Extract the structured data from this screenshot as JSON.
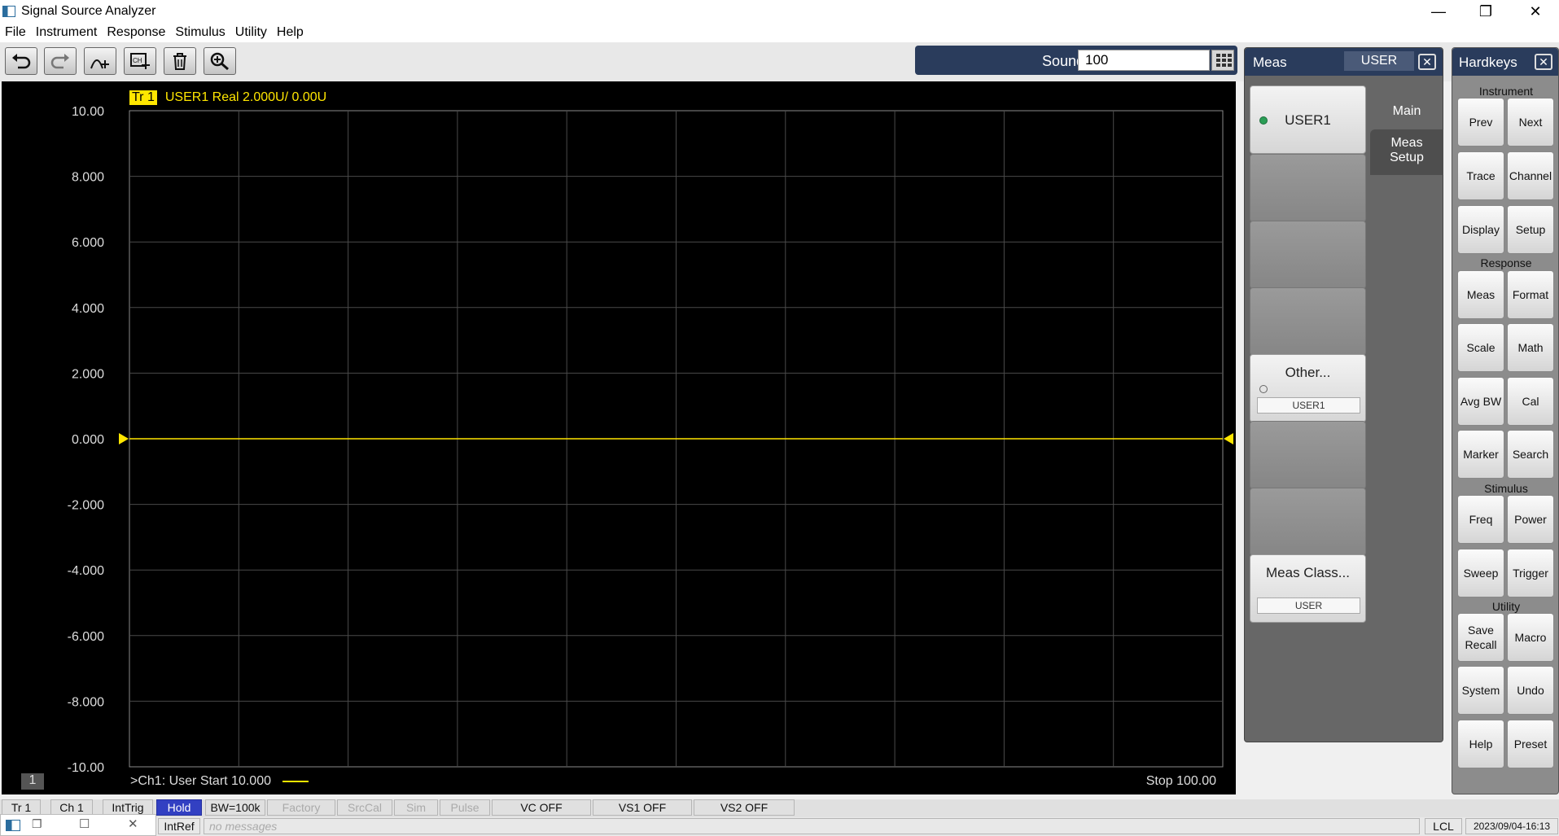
{
  "window": {
    "title": "Signal Source Analyzer"
  },
  "menu": [
    "File",
    "Instrument",
    "Response",
    "Stimulus",
    "Utility",
    "Help"
  ],
  "entry": {
    "label": "Sound",
    "value": "100"
  },
  "plot": {
    "trace_badge": "Tr 1",
    "trace_info": "USER1 Real 2.000U/  0.00U",
    "y_ticks": [
      "10.00",
      "8.000",
      "6.000",
      "4.000",
      "2.000",
      "0.000",
      "-2.000",
      "-4.000",
      "-6.000",
      "-8.000",
      "-10.00"
    ],
    "channel_number": "1",
    "footer_left": ">Ch1: User  Start  10.000",
    "footer_right": "Stop  100.00",
    "trace_color": "#ffe600"
  },
  "chart_data": {
    "type": "line",
    "x": [
      10.0,
      100.0
    ],
    "xlim": [
      10.0,
      100.0
    ],
    "ylim": [
      -10.0,
      10.0
    ],
    "series": [
      {
        "name": "USER1",
        "values": [
          0.0,
          0.0
        ]
      }
    ],
    "grid": true
  },
  "meas_panel": {
    "title": "Meas",
    "mode": "USER",
    "softkeys": [
      {
        "label": "USER1",
        "radio": "on",
        "sub": ""
      },
      {
        "label": "",
        "radio": "",
        "sub": ""
      },
      {
        "label": "",
        "radio": "",
        "sub": ""
      },
      {
        "label": "",
        "radio": "",
        "sub": ""
      },
      {
        "label": "Other...",
        "radio": "off",
        "sub": "USER1"
      },
      {
        "label": "",
        "radio": "",
        "sub": ""
      },
      {
        "label": "",
        "radio": "",
        "sub": ""
      },
      {
        "label": "Meas Class...",
        "radio": "",
        "sub": "USER"
      }
    ],
    "tabs": {
      "main": "Main",
      "meas_setup_line1": "Meas",
      "meas_setup_line2": "Setup"
    }
  },
  "hardkeys": {
    "title": "Hardkeys",
    "groups": {
      "instrument": "Instrument",
      "response": "Response",
      "stimulus": "Stimulus",
      "utility": "Utility"
    },
    "keys": {
      "prev": "Prev",
      "next": "Next",
      "trace": "Trace",
      "channel": "Channel",
      "display": "Display",
      "setup": "Setup",
      "meas": "Meas",
      "format": "Format",
      "scale": "Scale",
      "math": "Math",
      "avg_bw": "Avg BW",
      "cal": "Cal",
      "marker": "Marker",
      "search": "Search",
      "freq": "Freq",
      "power": "Power",
      "sweep": "Sweep",
      "trigger": "Trigger",
      "save": "Save",
      "recall": "Recall",
      "macro": "Macro",
      "system": "System",
      "undo": "Undo",
      "help": "Help",
      "preset": "Preset"
    }
  },
  "status": {
    "tr": "Tr 1",
    "ch": "Ch 1",
    "trig": "IntTrig",
    "hold": "Hold",
    "bw": "BW=100k",
    "factory": "Factory",
    "srccal": "SrcCal",
    "sim": "Sim",
    "pulse": "Pulse",
    "vc": "VC OFF",
    "vs1": "VS1 OFF",
    "vs2": "VS2 OFF",
    "ref": "IntRef",
    "messages": "no messages",
    "lcl": "LCL",
    "datetime": "2023/09/04-16:13"
  }
}
